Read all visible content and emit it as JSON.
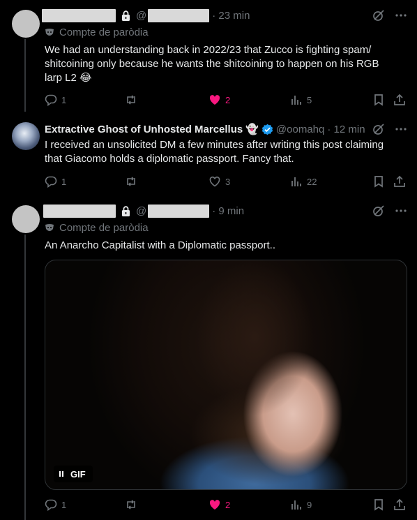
{
  "tweets": [
    {
      "time": "· 23 min",
      "handle_prefix": "@",
      "parody_label": "Compte de paròdia",
      "text": "We had an understanding back in 2022/23 that Zucco is fighting spam/ shitcoining only because he wants the shitcoining to happen on his RGB larp L2 😂",
      "replies": "1",
      "reposts": "",
      "likes": "2",
      "views": "5",
      "liked": true
    },
    {
      "name": "Extractive Ghost of Unhosted Marcellus",
      "name_emoji": "👻",
      "handle": "@oomahq",
      "time": "· 12 min",
      "text": "I received an unsolicited DM a few minutes after writing this post claiming that Giacomo holds a diplomatic passport. Fancy that.",
      "replies": "1",
      "reposts": "",
      "likes": "3",
      "views": "22",
      "liked": false
    },
    {
      "time": "· 9 min",
      "handle_prefix": "@",
      "parody_label": "Compte de paròdia",
      "text": "An Anarcho Capitalist with a Diplomatic passport..",
      "gif_label": "GIF",
      "replies": "1",
      "reposts": "",
      "likes": "2",
      "views": "9",
      "liked": true
    }
  ],
  "colors": {
    "background": "#000000",
    "text": "#e7e9ea",
    "muted": "#71767b",
    "like": "#f91880",
    "verified": "#1d9bf0"
  },
  "icons": [
    "lock-icon",
    "grok-icon",
    "more-icon",
    "parody-mask-icon",
    "reply-icon",
    "repost-icon",
    "like-icon",
    "views-icon",
    "bookmark-icon",
    "share-icon",
    "verified-icon",
    "pause-icon"
  ]
}
